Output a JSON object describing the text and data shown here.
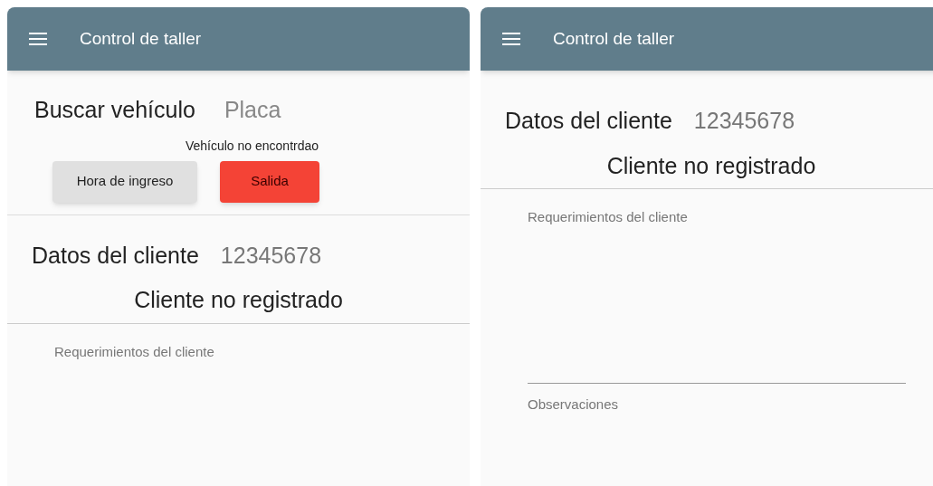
{
  "screens": [
    {
      "app_bar": {
        "title": "Control de taller"
      },
      "search": {
        "label": "Buscar vehículo",
        "placeholder": "Placa"
      },
      "message": "Vehículo no encontrdao",
      "buttons": [
        {
          "label": "Hora de ingreso",
          "kind": "default"
        },
        {
          "label": "Salida",
          "kind": "danger"
        }
      ],
      "client": {
        "label": "Datos del cliente",
        "value": "12345678",
        "status": "Cliente no registrado"
      },
      "fields": [
        {
          "placeholder": "Requerimientos del cliente"
        }
      ]
    },
    {
      "app_bar": {
        "title": "Control de taller"
      },
      "client": {
        "label": "Datos del cliente",
        "value": "12345678",
        "status": "Cliente no registrado"
      },
      "fields": [
        {
          "placeholder": "Requerimientos del cliente"
        },
        {
          "placeholder": "Observaciones"
        }
      ]
    }
  ]
}
